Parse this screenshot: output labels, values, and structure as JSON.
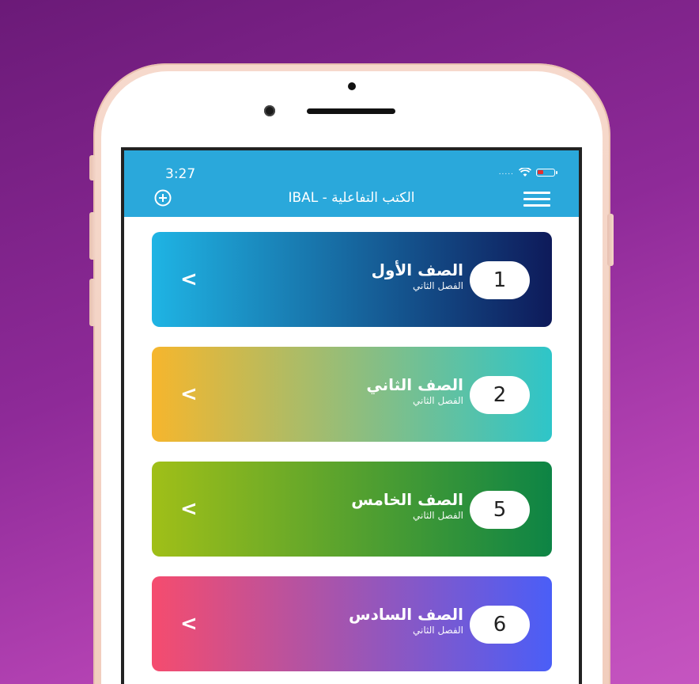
{
  "status_bar": {
    "time": "3:27",
    "signal": "....."
  },
  "header": {
    "title": "IBAL - الكتب التفاعلية",
    "background": "#2aa8db"
  },
  "icons": {
    "add": "plus-circle-icon",
    "menu": "hamburger-menu-icon",
    "chevron": "chevron-left-icon"
  },
  "chevron_glyph": "<",
  "cards": [
    {
      "number": "1",
      "title": "الصف الأول",
      "subtitle": "الفصل الثاني",
      "gradient": [
        "#1fb4e4",
        "#0e1a5a"
      ]
    },
    {
      "number": "2",
      "title": "الصف الثاني",
      "subtitle": "الفصل الثاني",
      "gradient": [
        "#f6b62d",
        "#2ec5c9"
      ]
    },
    {
      "number": "5",
      "title": "الصف الخامس",
      "subtitle": "الفصل الثاني",
      "gradient": [
        "#a0bf18",
        "#0d8445"
      ]
    },
    {
      "number": "6",
      "title": "الصف السادس",
      "subtitle": "الفصل الثاني",
      "gradient": [
        "#f54c6e",
        "#4a5ef7"
      ]
    }
  ]
}
